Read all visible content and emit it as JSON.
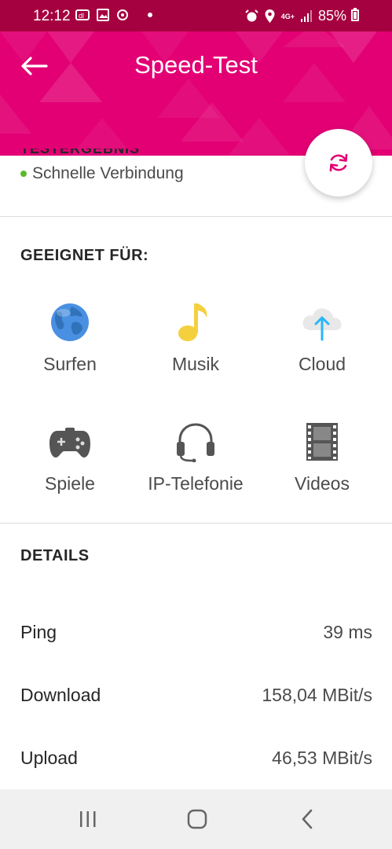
{
  "status_bar": {
    "time": "12:12",
    "network": "4G+",
    "battery": "85%",
    "icons": [
      "notification-app-icon",
      "image-icon",
      "sync-icon",
      "dot-icon",
      "alarm-icon",
      "location-icon",
      "signal-icon",
      "battery-icon"
    ]
  },
  "header": {
    "title": "Speed-Test",
    "back_icon": "arrow-left-icon",
    "color": "#e20074"
  },
  "refresh_icon": "refresh-icon",
  "result": {
    "label": "TESTERGEBNIS",
    "status": "Schnelle Verbindung",
    "status_color": "#5cb82a"
  },
  "suitable": {
    "title": "GEEIGNET FÜR:",
    "items": [
      {
        "label": "Surfen",
        "icon": "globe-icon"
      },
      {
        "label": "Musik",
        "icon": "music-note-icon"
      },
      {
        "label": "Cloud",
        "icon": "cloud-upload-icon"
      },
      {
        "label": "Spiele",
        "icon": "gamepad-icon"
      },
      {
        "label": "IP-Telefonie",
        "icon": "headset-icon"
      },
      {
        "label": "Videos",
        "icon": "film-icon"
      }
    ]
  },
  "details": {
    "title": "DETAILS",
    "rows": [
      {
        "label": "Ping",
        "value": "39 ms"
      },
      {
        "label": "Download",
        "value": "158,04 MBit/s"
      },
      {
        "label": "Upload",
        "value": "46,53 MBit/s"
      }
    ]
  },
  "nav": {
    "icons": [
      "recent-apps-icon",
      "home-icon",
      "back-icon"
    ]
  }
}
